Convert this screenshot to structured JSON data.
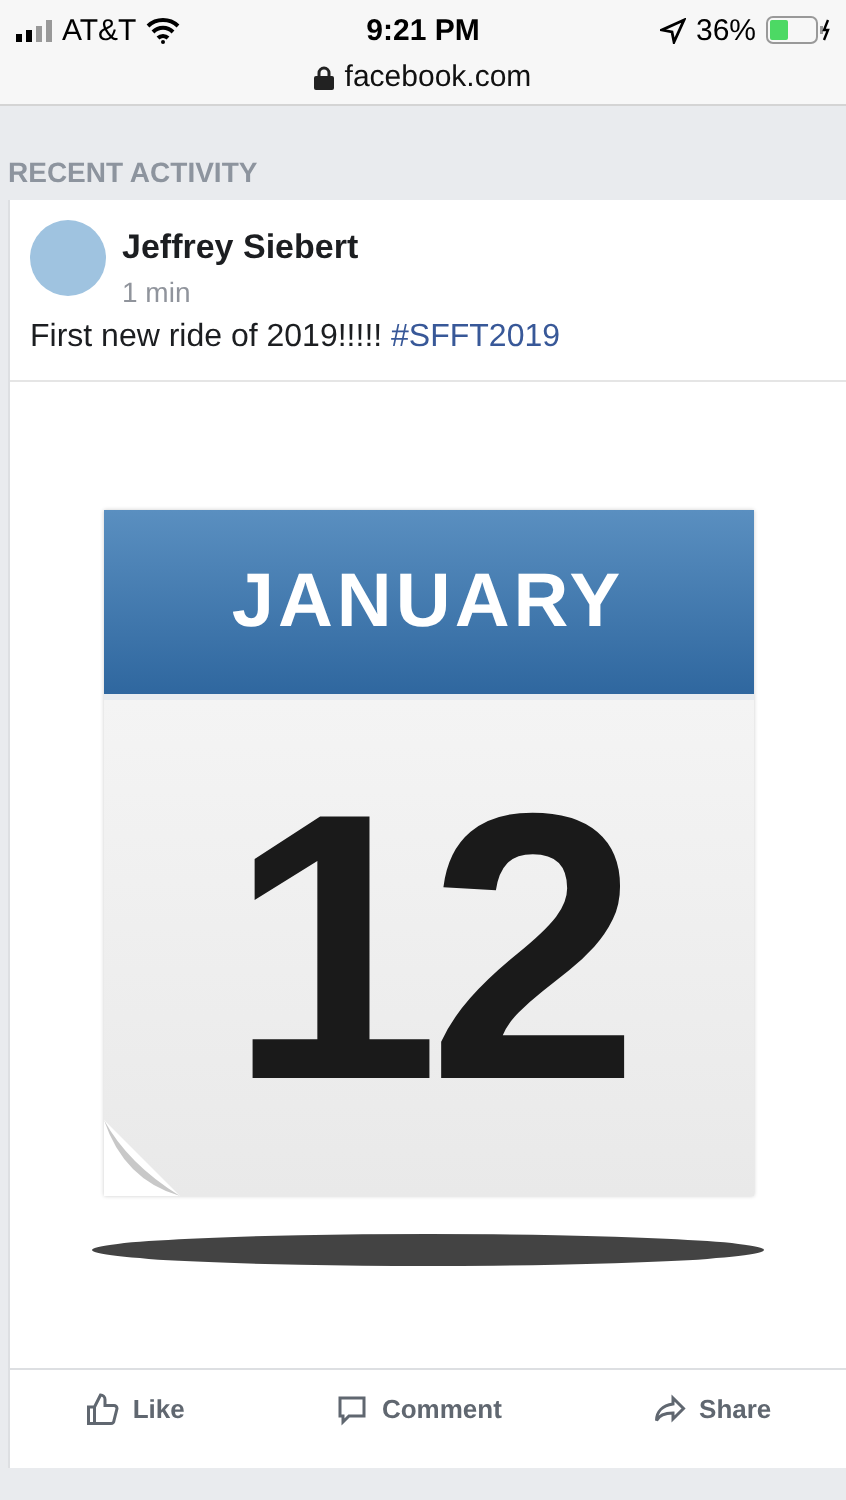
{
  "status_bar": {
    "carrier": "AT&T",
    "time": "9:21 PM",
    "battery": "36%"
  },
  "address_bar": {
    "url": "facebook.com"
  },
  "section_title": "RECENT ACTIVITY",
  "post": {
    "author": "Jeffrey Siebert",
    "time": "1 min",
    "text": "First new ride of 2019!!!!!",
    "hashtag": "#SFFT2019",
    "image": {
      "month": "JANUARY",
      "day": "12"
    },
    "actions": [
      {
        "kind": "like",
        "label": "Like"
      },
      {
        "kind": "comment",
        "label": "Comment"
      },
      {
        "kind": "share",
        "label": "Share"
      }
    ]
  }
}
